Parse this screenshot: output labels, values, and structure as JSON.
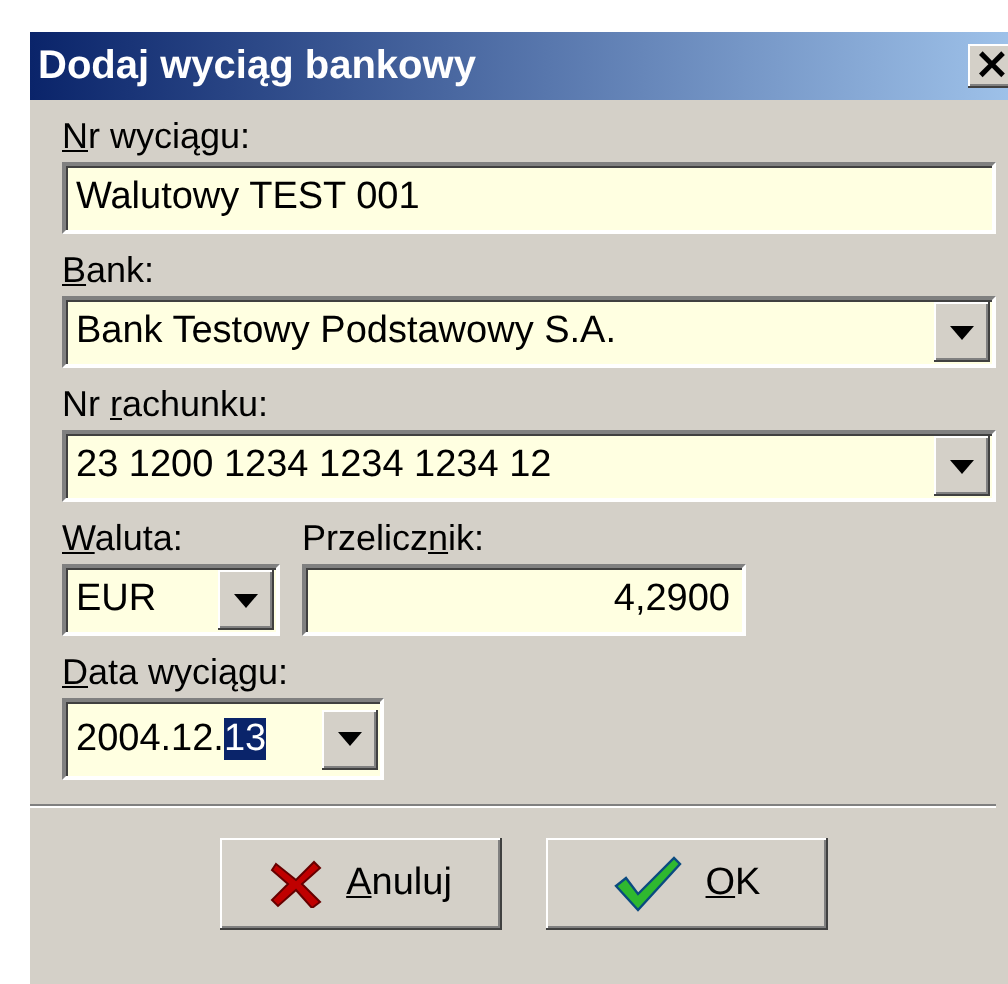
{
  "window": {
    "title": "Dodaj wyciąg bankowy",
    "close": "×"
  },
  "fields": [
    {
      "kind": "text",
      "label": {
        "key": "N",
        "after": "r wyciągu:"
      },
      "value": "Walutowy TEST 001"
    },
    {
      "kind": "combo",
      "label": {
        "key": "B",
        "after": "ank:"
      },
      "value": "Bank Testowy  Podstawowy S.A."
    },
    {
      "kind": "combo",
      "label": {
        "before": "Nr ",
        "key": "r",
        "after": "achunku:"
      },
      "value": "23 1200 1234 1234 1234 12"
    }
  ],
  "currency": {
    "label": {
      "key": "W",
      "after": "aluta:"
    },
    "value": "EUR"
  },
  "rate": {
    "label": {
      "before": "Przelicz",
      "key": "n",
      "after": "ik:"
    },
    "value": "4,2900"
  },
  "date": {
    "label": {
      "key": "D",
      "after": "ata wyciągu:"
    },
    "value": "2004.12.",
    "selection": "13"
  },
  "buttons": [
    {
      "kind": "cancel",
      "label": {
        "key": "A",
        "after": "nuluj"
      }
    },
    {
      "kind": "ok",
      "label": {
        "key": "O",
        "after": "K"
      }
    }
  ]
}
